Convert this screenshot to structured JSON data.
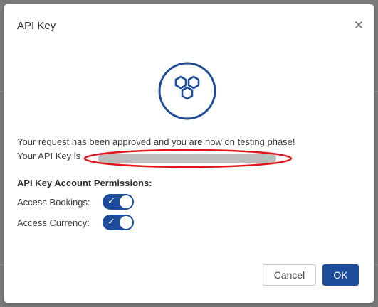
{
  "dialog": {
    "title": "API Key",
    "close_icon": "close-icon",
    "logo_icon": "hexagon-cluster-icon",
    "message_line1": "Your request has been approved and you are now on testing phase!",
    "message_line2_prefix": "Your API Key is",
    "api_key_redacted": true,
    "permissions": {
      "heading": "API Key Account Permissions:",
      "items": [
        {
          "label": "Access Bookings:",
          "enabled": true
        },
        {
          "label": "Access Currency:",
          "enabled": true
        }
      ]
    },
    "buttons": {
      "cancel_label": "Cancel",
      "ok_label": "OK"
    }
  },
  "colors": {
    "accent": "#1d4c9a",
    "redaction_fill": "#bdbdbd",
    "annotation_red": "#e3141b",
    "overlay": "#7a7a7a"
  }
}
